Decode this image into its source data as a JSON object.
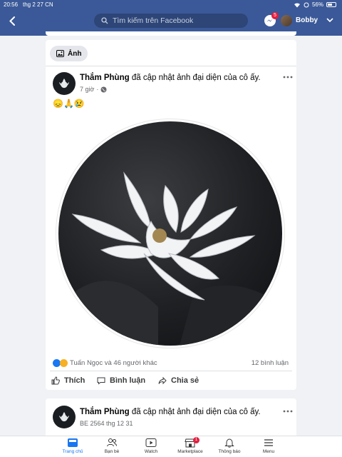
{
  "status_bar": {
    "time": "20:56",
    "date": "thg 2 27 CN",
    "battery": "56%",
    "battery_level": 0.56
  },
  "header": {
    "search_placeholder": "Tìm kiếm trên Facebook",
    "messenger_badge": "5",
    "user_name": "Bobby"
  },
  "filter_chip": {
    "label": "Ảnh"
  },
  "post": {
    "author": "Thắm Phùng",
    "action": "đã cập nhật ảnh đại diện của cô ấy.",
    "time": "7 giờ",
    "privacy_icon": "globe-icon",
    "text": "😞🙏😢",
    "reactions_summary": "Tuấn Ngọc và 46 người khác",
    "comments_count": "12 bình luận",
    "actions": {
      "like": "Thích",
      "comment": "Bình luận",
      "share": "Chia sẻ"
    }
  },
  "next_post": {
    "author": "Thắm Phùng",
    "action": "đã cập nhật ảnh đại diện của cô ấy.",
    "time": "BE 2564 thg 12 31"
  },
  "bottom_nav": [
    {
      "label": "Trang chủ",
      "icon": "home-icon",
      "active": true
    },
    {
      "label": "Bạn bè",
      "icon": "friends-icon"
    },
    {
      "label": "Watch",
      "icon": "watch-icon"
    },
    {
      "label": "Marketplace",
      "icon": "marketplace-icon",
      "badge": "1"
    },
    {
      "label": "Thông báo",
      "icon": "bell-icon"
    },
    {
      "label": "Menu",
      "icon": "menu-icon"
    }
  ],
  "colors": {
    "brand_blue": "#3b5998",
    "link_blue": "#1877f2",
    "badge_red": "#e41e3f"
  }
}
